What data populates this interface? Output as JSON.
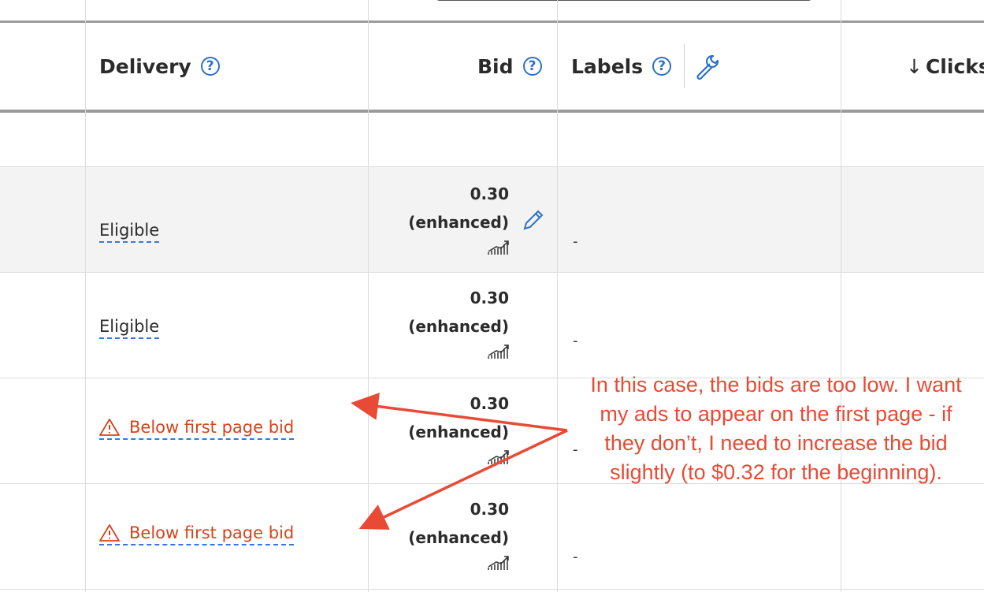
{
  "header": {
    "delivery": "Delivery",
    "bid": "Bid",
    "labels": "Labels",
    "clicks": "Clicks",
    "help_glyph": "?",
    "sort_arrow": "↓"
  },
  "rows": [
    {
      "delivery": "",
      "bid_value": "",
      "bid_note": "",
      "labels": ""
    },
    {
      "delivery": "Eligible",
      "bid_value": "0.30",
      "bid_note": "(enhanced)",
      "labels": "-",
      "shaded": true
    },
    {
      "delivery": "Eligible",
      "bid_value": "0.30",
      "bid_note": "(enhanced)",
      "labels": "-"
    },
    {
      "delivery": "Below first page bid",
      "bid_value": "0.30",
      "bid_note": "(enhanced)",
      "labels": "-",
      "warning": true
    },
    {
      "delivery": "Below first page bid",
      "bid_value": "0.30",
      "bid_note": "(enhanced)",
      "labels": "-",
      "warning": true
    }
  ],
  "annotation": {
    "text": "In this case, the bids are too low. I want my ads to appear on the first page - if they don’t, I need to increase the bid slightly (to $0.32 for the beginning).",
    "color": "#e84a35"
  },
  "colors": {
    "help_blue": "#2b71c9",
    "warning_red": "#d4441c",
    "shaded_row": "#f3f3f3",
    "divider": "#dcdcdc"
  },
  "icons": [
    "help-circle-icon",
    "wrench-icon",
    "pencil-icon",
    "warning-triangle-icon",
    "trend-chart-icon",
    "sort-down-icon"
  ]
}
